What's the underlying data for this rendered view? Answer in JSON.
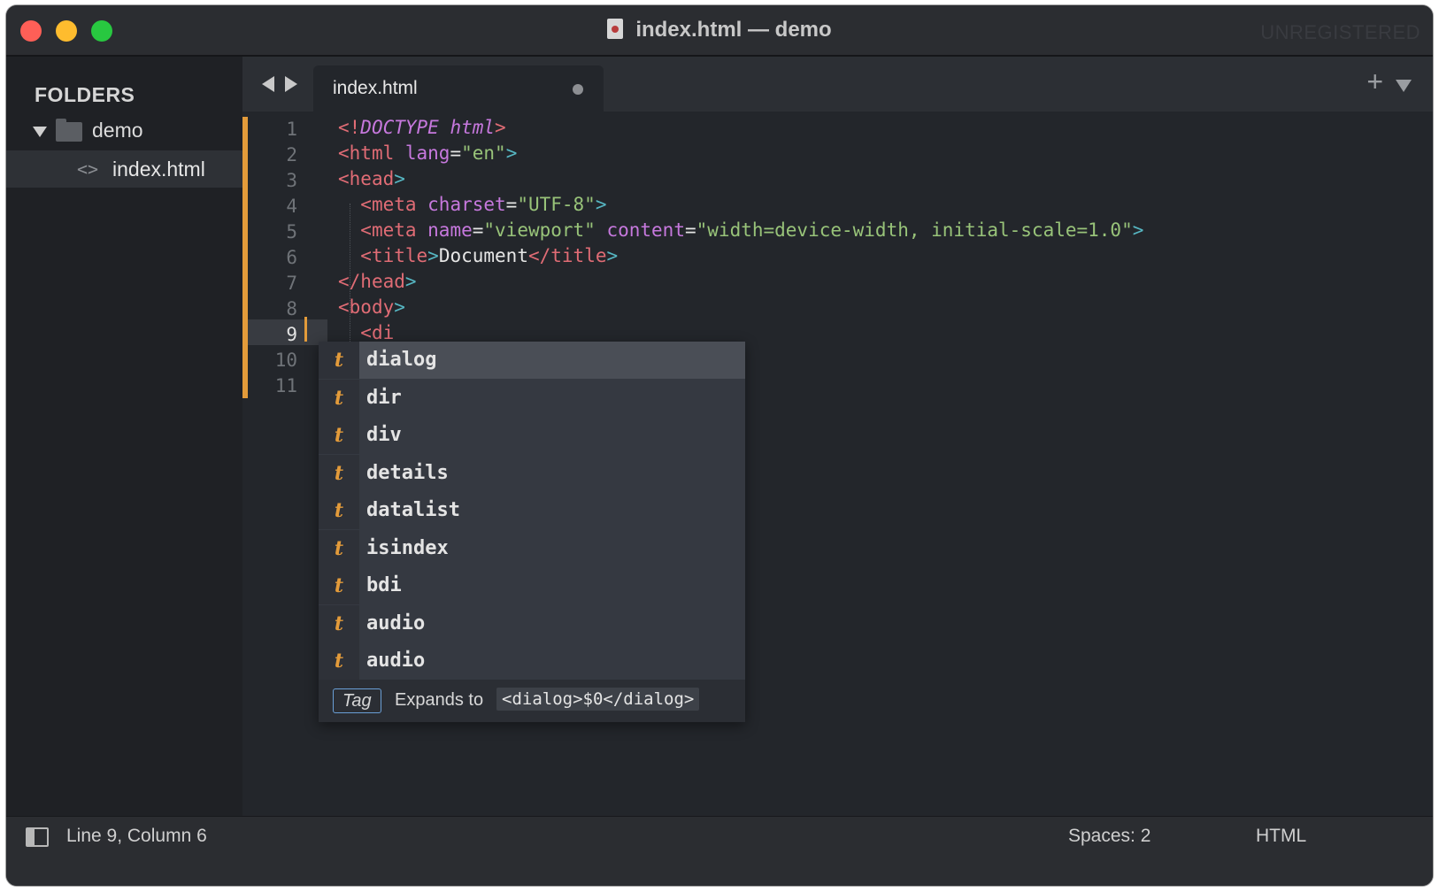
{
  "window": {
    "title": "index.html — demo",
    "badge": "UNREGISTERED"
  },
  "sidebar": {
    "header": "FOLDERS",
    "folder": "demo",
    "file": "index.html",
    "file_icon": "<>"
  },
  "tabs": {
    "active_label": "index.html",
    "modified": true,
    "new_tab_label": "+"
  },
  "editor": {
    "line_numbers": [
      "1",
      "2",
      "3",
      "4",
      "5",
      "6",
      "7",
      "8",
      "9",
      "10",
      "11"
    ],
    "current_line": 9,
    "lines": [
      [
        {
          "t": "<!",
          "c": "punct"
        },
        {
          "t": "DOCTYPE html",
          "c": "doctype"
        },
        {
          "t": ">",
          "c": "punct"
        }
      ],
      [
        {
          "t": "<",
          "c": "punct"
        },
        {
          "t": "html",
          "c": "tag"
        },
        {
          "t": " lang",
          "c": "attr"
        },
        {
          "t": "=",
          "c": "text"
        },
        {
          "t": "\"en\"",
          "c": "str"
        },
        {
          "t": ">",
          "c": "punct2"
        }
      ],
      [
        {
          "t": "<",
          "c": "punct"
        },
        {
          "t": "head",
          "c": "tag"
        },
        {
          "t": ">",
          "c": "punct2"
        }
      ],
      [
        {
          "t": "  <",
          "c": "punct"
        },
        {
          "t": "meta",
          "c": "tag"
        },
        {
          "t": " charset",
          "c": "attr"
        },
        {
          "t": "=",
          "c": "text"
        },
        {
          "t": "\"UTF-8\"",
          "c": "str"
        },
        {
          "t": ">",
          "c": "punct2"
        }
      ],
      [
        {
          "t": "  <",
          "c": "punct"
        },
        {
          "t": "meta",
          "c": "tag"
        },
        {
          "t": " name",
          "c": "attr"
        },
        {
          "t": "=",
          "c": "text"
        },
        {
          "t": "\"viewport\"",
          "c": "str"
        },
        {
          "t": " content",
          "c": "attr"
        },
        {
          "t": "=",
          "c": "text"
        },
        {
          "t": "\"width=device-width, initial-scale=1.0\"",
          "c": "str"
        },
        {
          "t": ">",
          "c": "punct2"
        }
      ],
      [
        {
          "t": "  <",
          "c": "punct"
        },
        {
          "t": "title",
          "c": "tag"
        },
        {
          "t": ">",
          "c": "punct2"
        },
        {
          "t": "Document",
          "c": "text"
        },
        {
          "t": "</",
          "c": "punct"
        },
        {
          "t": "title",
          "c": "tag"
        },
        {
          "t": ">",
          "c": "punct2"
        }
      ],
      [
        {
          "t": "</",
          "c": "punct"
        },
        {
          "t": "head",
          "c": "tag"
        },
        {
          "t": ">",
          "c": "punct2"
        }
      ],
      [
        {
          "t": "<",
          "c": "punct"
        },
        {
          "t": "body",
          "c": "tag"
        },
        {
          "t": ">",
          "c": "punct2"
        }
      ],
      [
        {
          "t": "  <",
          "c": "punct"
        },
        {
          "t": "di",
          "c": "tag"
        }
      ],
      [],
      []
    ]
  },
  "autocomplete": {
    "kind_symbol": "t",
    "items": [
      "dialog",
      "dir",
      "div",
      "details",
      "datalist",
      "isindex",
      "bdi",
      "audio",
      "audio"
    ],
    "selected_index": 0,
    "footer": {
      "kind_label": "Tag",
      "expands_label": "Expands to",
      "expansion": "<dialog>$0</dialog>"
    }
  },
  "statusbar": {
    "position": "Line 9, Column 6",
    "indentation": "Spaces: 2",
    "syntax": "HTML"
  },
  "colors": {
    "accent": "#e39b3a",
    "tag": "#e06c75",
    "attribute": "#c678dd",
    "string": "#98c379",
    "bracket_close": "#56b6c2"
  }
}
